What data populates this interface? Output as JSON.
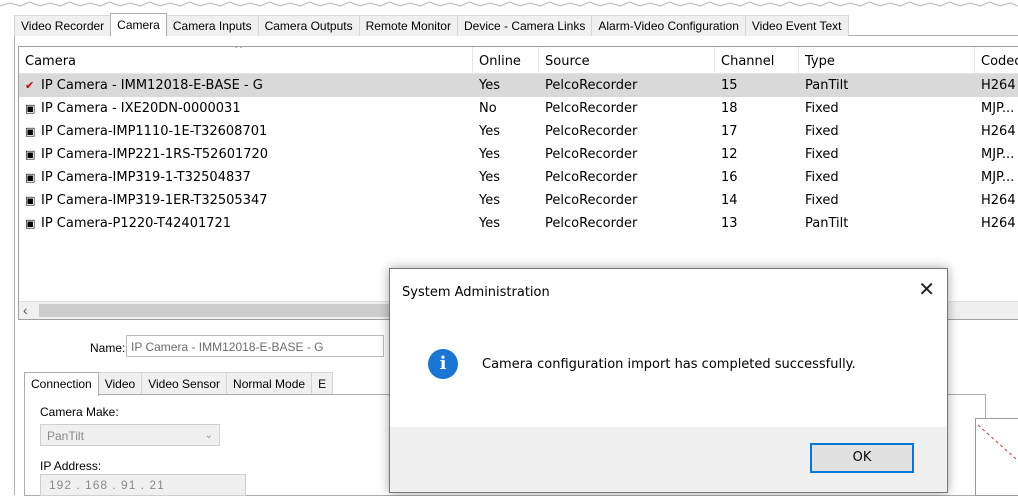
{
  "tabs": [
    "Video Recorder",
    "Camera",
    "Camera Inputs",
    "Camera Outputs",
    "Remote Monitor",
    "Device - Camera Links",
    "Alarm-Video Configuration",
    "Video Event Text"
  ],
  "active_tab": "Camera",
  "grid": {
    "headers": [
      "Camera",
      "Online",
      "Source",
      "Channel",
      "Type",
      "Codec"
    ],
    "rows": [
      {
        "icon": "checked-camera-icon",
        "camera": "IP Camera - IMM12018-E-BASE - G",
        "online": "Yes",
        "source": "PelcoRecorder",
        "channel": "15",
        "type": "PanTilt",
        "codec": "H264",
        "selected": true
      },
      {
        "icon": "camera-icon",
        "camera": "IP Camera - IXE20DN-0000031",
        "online": "No",
        "source": "PelcoRecorder",
        "channel": "18",
        "type": "Fixed",
        "codec": "MJP...",
        "selected": false
      },
      {
        "icon": "camera-icon",
        "camera": "IP Camera-IMP1110-1E-T32608701",
        "online": "Yes",
        "source": "PelcoRecorder",
        "channel": "17",
        "type": "Fixed",
        "codec": "H264",
        "selected": false
      },
      {
        "icon": "camera-icon",
        "camera": "IP Camera-IMP221-1RS-T52601720",
        "online": "Yes",
        "source": "PelcoRecorder",
        "channel": "12",
        "type": "Fixed",
        "codec": "MJP...",
        "selected": false
      },
      {
        "icon": "camera-icon",
        "camera": "IP Camera-IMP319-1-T32504837",
        "online": "Yes",
        "source": "PelcoRecorder",
        "channel": "16",
        "type": "Fixed",
        "codec": "MJP...",
        "selected": false
      },
      {
        "icon": "camera-icon",
        "camera": "IP Camera-IMP319-1ER-T32505347",
        "online": "Yes",
        "source": "PelcoRecorder",
        "channel": "14",
        "type": "Fixed",
        "codec": "H264",
        "selected": false
      },
      {
        "icon": "camera-icon",
        "camera": "IP Camera-P1220-T42401721",
        "online": "Yes",
        "source": "PelcoRecorder",
        "channel": "13",
        "type": "PanTilt",
        "codec": "H264",
        "selected": false
      }
    ]
  },
  "details": {
    "name_label": "Name:",
    "name_value": "IP Camera - IMM12018-E-BASE - G",
    "subtabs": [
      "Connection",
      "Video",
      "Video Sensor",
      "Normal Mode",
      "E"
    ],
    "active_subtab": "Connection",
    "camera_make_label": "Camera Make:",
    "camera_make_value": "PanTilt",
    "ip_label": "IP Address:",
    "ip_value": "192 . 168 . 91 . 21"
  },
  "dialog": {
    "title": "System Administration",
    "close_glyph": "✕",
    "icon": "info-icon",
    "message": "Camera configuration import has completed successfully.",
    "ok_label": "OK"
  },
  "colors": {
    "selected_row": "#d9d9d9",
    "info_blue": "#1a76d2",
    "focus_blue": "#0078d7"
  }
}
